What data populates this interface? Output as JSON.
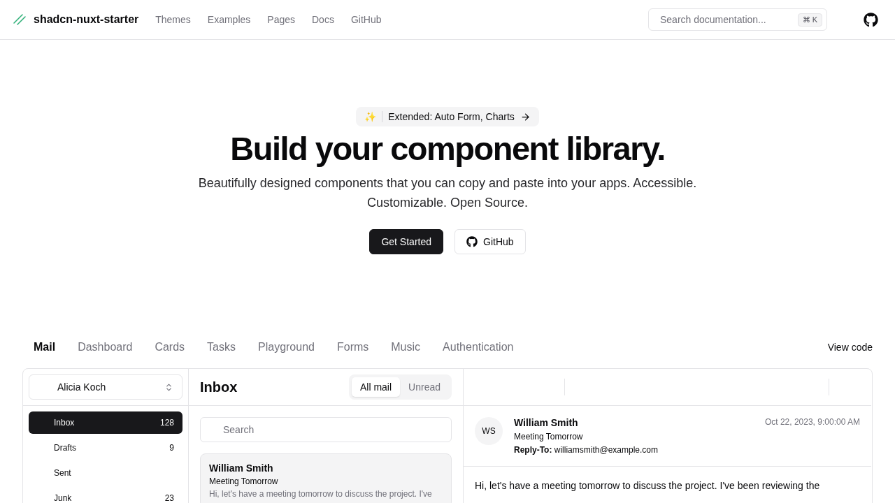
{
  "header": {
    "brand": "shadcn-nuxt-starter",
    "nav": [
      "Themes",
      "Examples",
      "Pages",
      "Docs",
      "GitHub"
    ],
    "search": {
      "placeholder": "Search documentation...",
      "shortcut": "⌘ K"
    }
  },
  "hero": {
    "badge": {
      "emoji": "✨",
      "text": "Extended: Auto Form, Charts"
    },
    "title": "Build your component library.",
    "subtitle": "Beautifully designed components that you can copy and paste into your apps. Accessible. Customizable. Open Source.",
    "buttons": [
      {
        "label": "Get Started",
        "kind": "primary"
      },
      {
        "label": "GitHub",
        "kind": "outline"
      }
    ]
  },
  "examples": {
    "tabs": [
      {
        "label": "Mail",
        "selected": true
      },
      {
        "label": "Dashboard",
        "selected": false
      },
      {
        "label": "Cards",
        "selected": false
      },
      {
        "label": "Tasks",
        "selected": false
      },
      {
        "label": "Playground",
        "selected": false
      },
      {
        "label": "Forms",
        "selected": false
      },
      {
        "label": "Music",
        "selected": false
      },
      {
        "label": "Authentication",
        "selected": false
      }
    ],
    "view_code": "View code"
  },
  "mail": {
    "account": "Alicia Koch",
    "folders": [
      {
        "label": "Inbox",
        "count": "128",
        "selected": true
      },
      {
        "label": "Drafts",
        "count": "9",
        "selected": false
      },
      {
        "label": "Sent",
        "selected": false
      },
      {
        "label": "Junk",
        "count": "23",
        "selected": false
      }
    ],
    "list_title": "Inbox",
    "filters": [
      {
        "label": "All mail",
        "selected": true
      },
      {
        "label": "Unread",
        "selected": false
      }
    ],
    "search": {
      "placeholder": "Search"
    },
    "messages": [
      {
        "name": "William Smith",
        "subject": "Meeting Tomorrow",
        "preview": "Hi, let's have a meeting tomorrow to discuss the project. I've"
      }
    ],
    "display": {
      "initials": "WS",
      "name": "William Smith",
      "subject": "Meeting Tomorrow",
      "reply_to": "**Reply-To:** williamsmith@example.com",
      "date": "Oct 22, 2023, 9:00:00 AM",
      "body": "Hi, let's have a meeting tomorrow to discuss the project. I've been reviewing the"
    }
  }
}
